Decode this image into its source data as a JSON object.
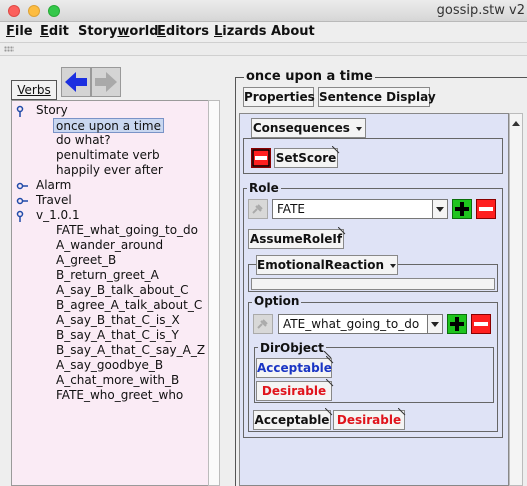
{
  "window": {
    "title": "gossip.stw v2"
  },
  "menu": [
    {
      "label": "File",
      "mnemonic_index": 0
    },
    {
      "label": "Edit",
      "mnemonic_index": 0
    },
    {
      "label": "Storyworld",
      "mnemonic_index": 5
    },
    {
      "label": "Editors",
      "mnemonic_index": 0
    },
    {
      "label": "Lizards",
      "mnemonic_index": 0
    },
    {
      "label": "About",
      "mnemonic_index": -1
    }
  ],
  "left": {
    "verbs_label": "Verbs",
    "tree": [
      {
        "label": "Story",
        "kind": "open"
      },
      {
        "label": "once upon a time",
        "kind": "leaf",
        "selected": true
      },
      {
        "label": "do what?",
        "kind": "leaf"
      },
      {
        "label": "penultimate verb",
        "kind": "leaf"
      },
      {
        "label": "happily ever after",
        "kind": "leaf"
      },
      {
        "label": "Alarm",
        "kind": "closed"
      },
      {
        "label": "Travel",
        "kind": "closed"
      },
      {
        "label": "v_1.0.1",
        "kind": "open"
      },
      {
        "label": "FATE_what_going_to_do",
        "kind": "leaf"
      },
      {
        "label": "A_wander_around",
        "kind": "leaf"
      },
      {
        "label": "A_greet_B",
        "kind": "leaf"
      },
      {
        "label": "B_return_greet_A",
        "kind": "leaf"
      },
      {
        "label": "A_say_B_talk_about_C",
        "kind": "leaf"
      },
      {
        "label": "B_agree_A_talk_about_C",
        "kind": "leaf"
      },
      {
        "label": "A_say_B_that_C_is_X",
        "kind": "leaf"
      },
      {
        "label": "B_say_A_that_C_is_Y",
        "kind": "leaf"
      },
      {
        "label": "B_say_A_that_C_say_A_Z",
        "kind": "leaf"
      },
      {
        "label": "A_say_goodbye_B",
        "kind": "leaf"
      },
      {
        "label": "A_chat_more_with_B",
        "kind": "leaf"
      },
      {
        "label": "FATE_who_greet_who",
        "kind": "leaf"
      }
    ]
  },
  "right": {
    "verb_title": "once upon a time",
    "properties_label": "Properties",
    "sentence_display_label": "Sentence Display",
    "consequences_label": "Consequences",
    "setscore_label": "SetScore",
    "role_label": "Role",
    "role_value": "FATE",
    "assume_role_label": "AssumeRoleIf",
    "emotional_reaction_label": "EmotionalReaction",
    "option_label": "Option",
    "option_value": "ATE_what_going_to_do",
    "dirobject_label": "DirObject",
    "acceptable_label": "Acceptable",
    "desirable_label": "Desirable",
    "option_acceptable_label": "Acceptable",
    "option_desirable_label": "Desirable"
  },
  "colors": {
    "acceptable_text": "#1a35c4",
    "desirable_text": "#e0141b",
    "tree_bg": "#faebf5",
    "panel_bg": "#dfe3f6",
    "add_green": "#1ec41e",
    "delete_red": "#ff1f1f",
    "nav_arrow_blue": "#1b2fe0"
  },
  "icons": [
    "back-arrow-icon",
    "forward-arrow-icon",
    "tree-expanded-icon",
    "tree-collapsed-icon",
    "plus-icon",
    "minus-icon",
    "chevron-down-icon",
    "pin-icon",
    "corner-fold-icon"
  ]
}
